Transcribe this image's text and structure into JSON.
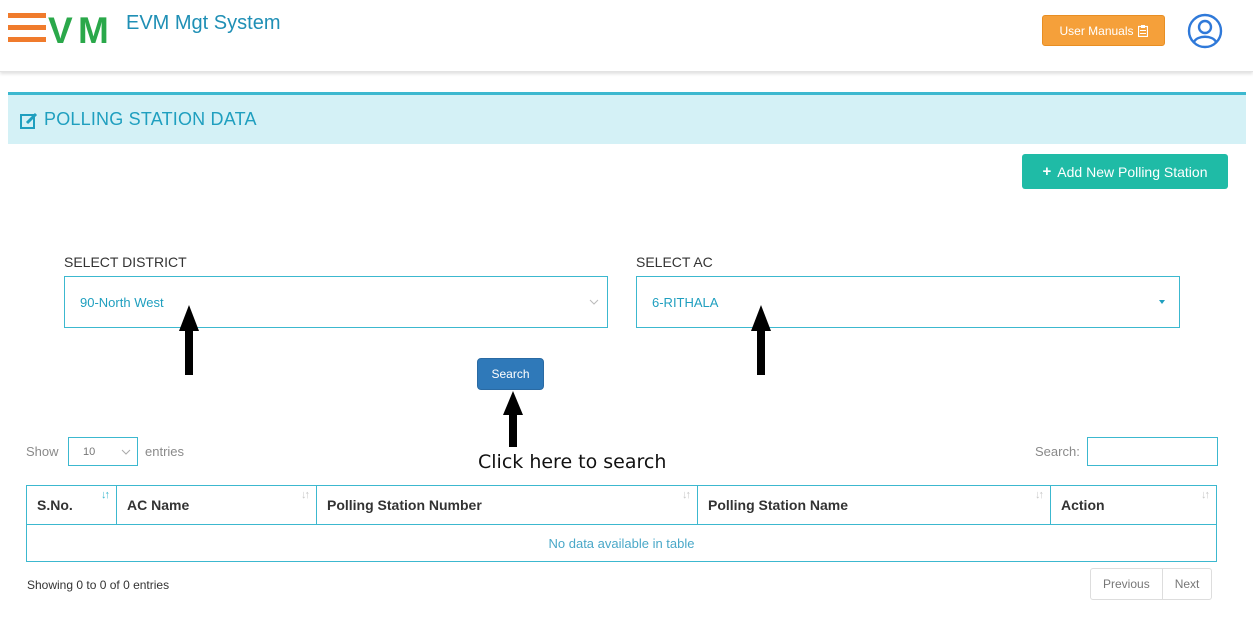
{
  "header": {
    "brand_title": "EVM Mgt System",
    "manual_label": "User Manuals",
    "colors": {
      "logo_orange": "#f07b2c",
      "logo_green": "#2aa84a",
      "brand_blue": "#1f8fb5",
      "manual_orange": "#f5a03a"
    }
  },
  "panel": {
    "title": "POLLING STATION DATA",
    "add_label": "Add New Polling Station",
    "accent": "#3cb8cf",
    "header_bg": "#d4f1f6"
  },
  "filters": {
    "district_label": "SELECT DISTRICT",
    "district_value": "90-North West",
    "ac_label": "SELECT AC",
    "ac_value": "6-RITHALA",
    "search_label": "Search"
  },
  "annotation": {
    "note": "Click here to search"
  },
  "table": {
    "show_label": "Show",
    "page_length": "10",
    "entries_label": "entries",
    "search_label": "Search:",
    "columns": [
      "S.No.",
      "AC Name",
      "Polling Station Number",
      "Polling Station Name",
      "Action"
    ],
    "empty_message": "No data available in table",
    "info": "Showing 0 to 0 of 0 entries",
    "prev_label": "Previous",
    "next_label": "Next"
  },
  "icons": [
    "menu-logo-icon",
    "user-circle-icon",
    "clipboard-icon",
    "edit-icon",
    "plus-icon",
    "chevron-down-icon",
    "caret-down-icon",
    "sort-icon",
    "arrow-up-icon"
  ]
}
